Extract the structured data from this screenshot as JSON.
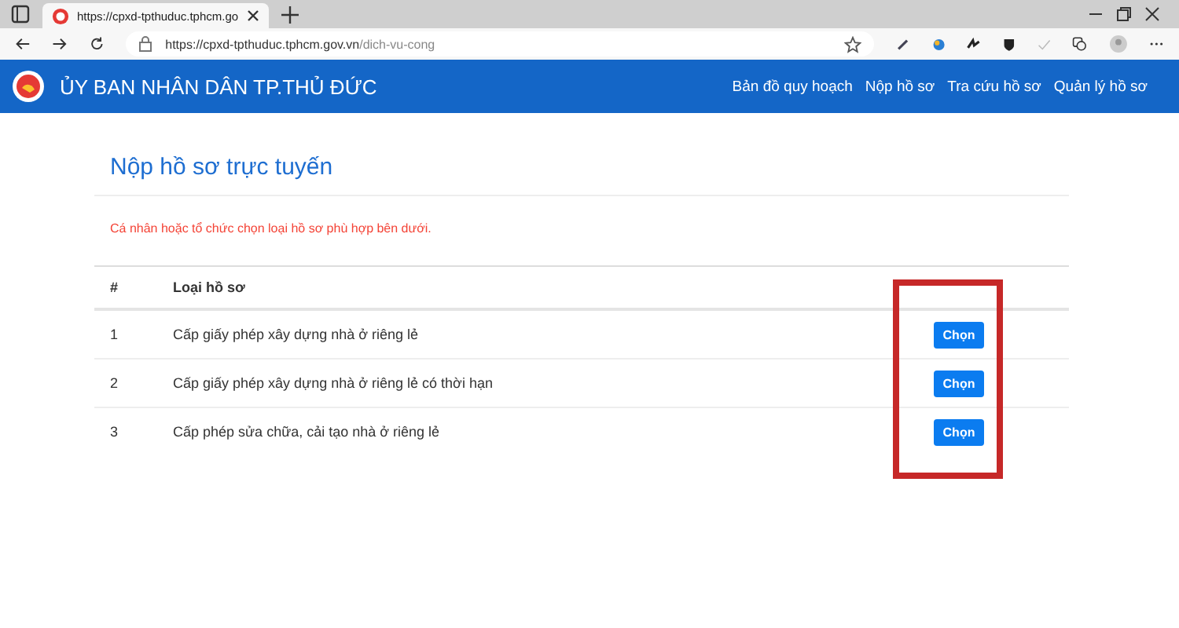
{
  "browser": {
    "tab_title": "https://cpxd-tpthuduc.tphcm.go",
    "url_host": "https://cpxd-tpthuduc.tphcm.gov.vn",
    "url_path": "/dich-vu-cong"
  },
  "navbar": {
    "brand": "ỦY BAN NHÂN DÂN TP.THỦ ĐỨC",
    "links": [
      "Bản đồ quy hoạch",
      "Nộp hồ sơ",
      "Tra cứu hồ sơ",
      "Quản lý hồ sơ"
    ]
  },
  "page": {
    "title": "Nộp hồ sơ trực tuyến",
    "notice": "Cá nhân hoặc tổ chức chọn loại hồ sơ phù hợp bên dưới.",
    "table": {
      "columns": [
        "#",
        "Loại hồ sơ"
      ],
      "rows": [
        {
          "index": "1",
          "name": "Cấp giấy phép xây dựng nhà ở riêng lẻ",
          "action": "Chọn"
        },
        {
          "index": "2",
          "name": "Cấp giấy phép xây dựng nhà ở riêng lẻ có thời hạn",
          "action": "Chọn"
        },
        {
          "index": "3",
          "name": "Cấp phép sửa chữa, cải tạo nhà ở riêng lẻ",
          "action": "Chọn"
        }
      ]
    }
  }
}
